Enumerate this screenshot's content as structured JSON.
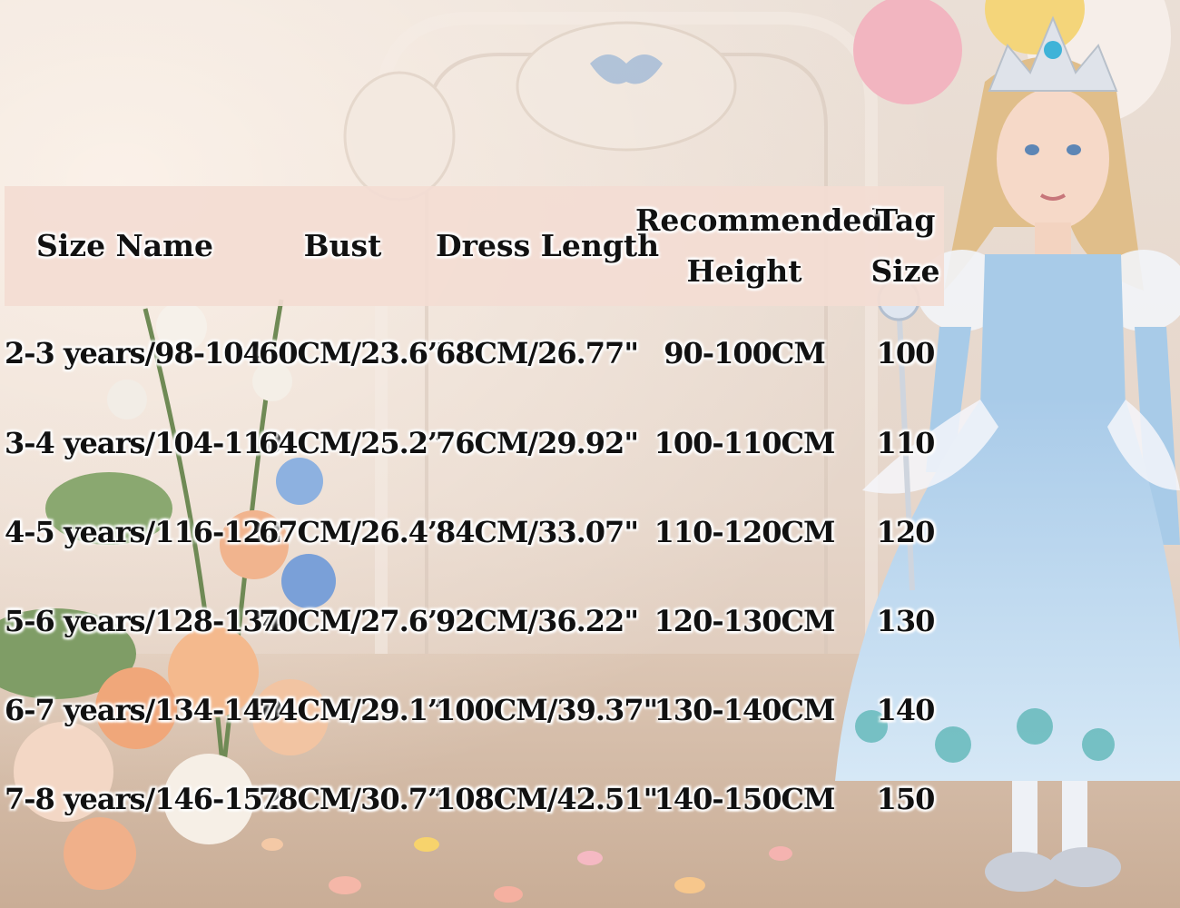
{
  "size_chart": {
    "headers": {
      "size_name": "Size Name",
      "bust": "Bust",
      "dress_length": "Dress Length",
      "recommended_height_line1": "Recommended",
      "recommended_height_line2": "Height",
      "tag_size_line1": "Tag",
      "tag_size_line2": "Size"
    },
    "rows": [
      {
        "size_name": "2-3 years/98-104",
        "bust": "60CM/23.6”",
        "dress_length": "68CM/26.77\"",
        "height": "90-100CM",
        "tag": "100"
      },
      {
        "size_name": "3-4 years/104-110",
        "bust": "64CM/25.2”",
        "dress_length": "76CM/29.92\"",
        "height": "100-110CM",
        "tag": "110"
      },
      {
        "size_name": "4-5 years/116-122",
        "bust": "67CM/26.4”",
        "dress_length": "84CM/33.07\"",
        "height": "110-120CM",
        "tag": "120"
      },
      {
        "size_name": "5-6 years/128-134",
        "bust": "70CM/27.6”",
        "dress_length": "92CM/36.22\"",
        "height": "120-130CM",
        "tag": "130"
      },
      {
        "size_name": "6-7 years/134-140",
        "bust": "74CM/29.1”",
        "dress_length": "100CM/39.37\"",
        "height": "130-140CM",
        "tag": "140"
      },
      {
        "size_name": "7-8 years/146-152",
        "bust": "78CM/30.7”",
        "dress_length": "108CM/42.51\"",
        "height": "140-150CM",
        "tag": "150"
      }
    ]
  },
  "colors": {
    "header_band": "#f3ddd3",
    "wall": "#e9ddd3",
    "floor": "#d9c2b0",
    "dress": "#b9d6ee"
  },
  "background_image": {
    "icons": [
      "wall-ornament",
      "balloon-pink",
      "balloon-yellow",
      "flower-arrangement",
      "girl-in-princess-dress",
      "tiara",
      "magic-wand",
      "rose-petals"
    ]
  }
}
